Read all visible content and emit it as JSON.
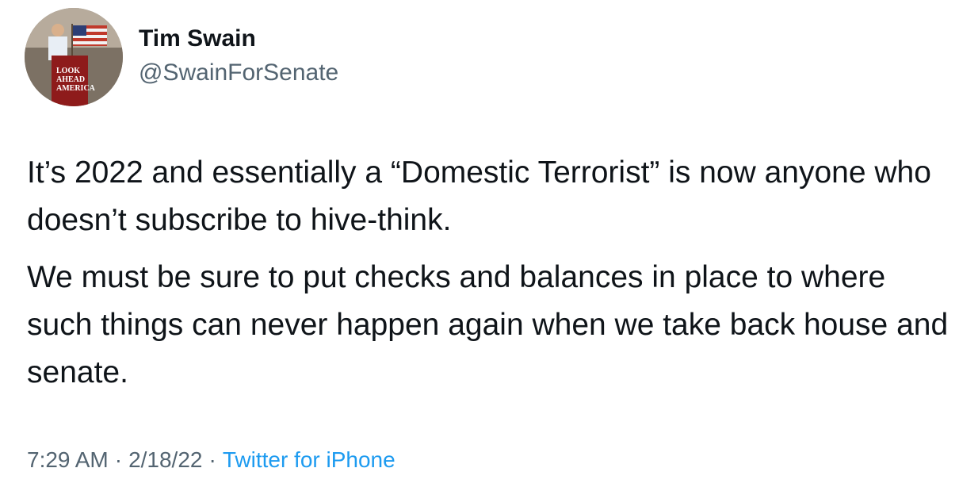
{
  "author": {
    "display_name": "Tim Swain",
    "handle": "@SwainForSenate",
    "avatar_icon": "avatar-photo",
    "avatar_sign_text": "LOOK AHEAD AMERICA"
  },
  "tweet": {
    "paragraphs": [
      "It’s 2022 and essentially a “Domestic Terrorist” is now anyone who doesn’t subscribe to hive-think.",
      "We must be sure to put checks and balances in place to where such things can never happen again when we take back house and senate."
    ]
  },
  "meta": {
    "time": "7:29 AM",
    "separator": "·",
    "date": "2/18/22",
    "source": "Twitter for iPhone"
  },
  "colors": {
    "text": "#0f1419",
    "secondary": "#536471",
    "link": "#1d9bf0"
  }
}
